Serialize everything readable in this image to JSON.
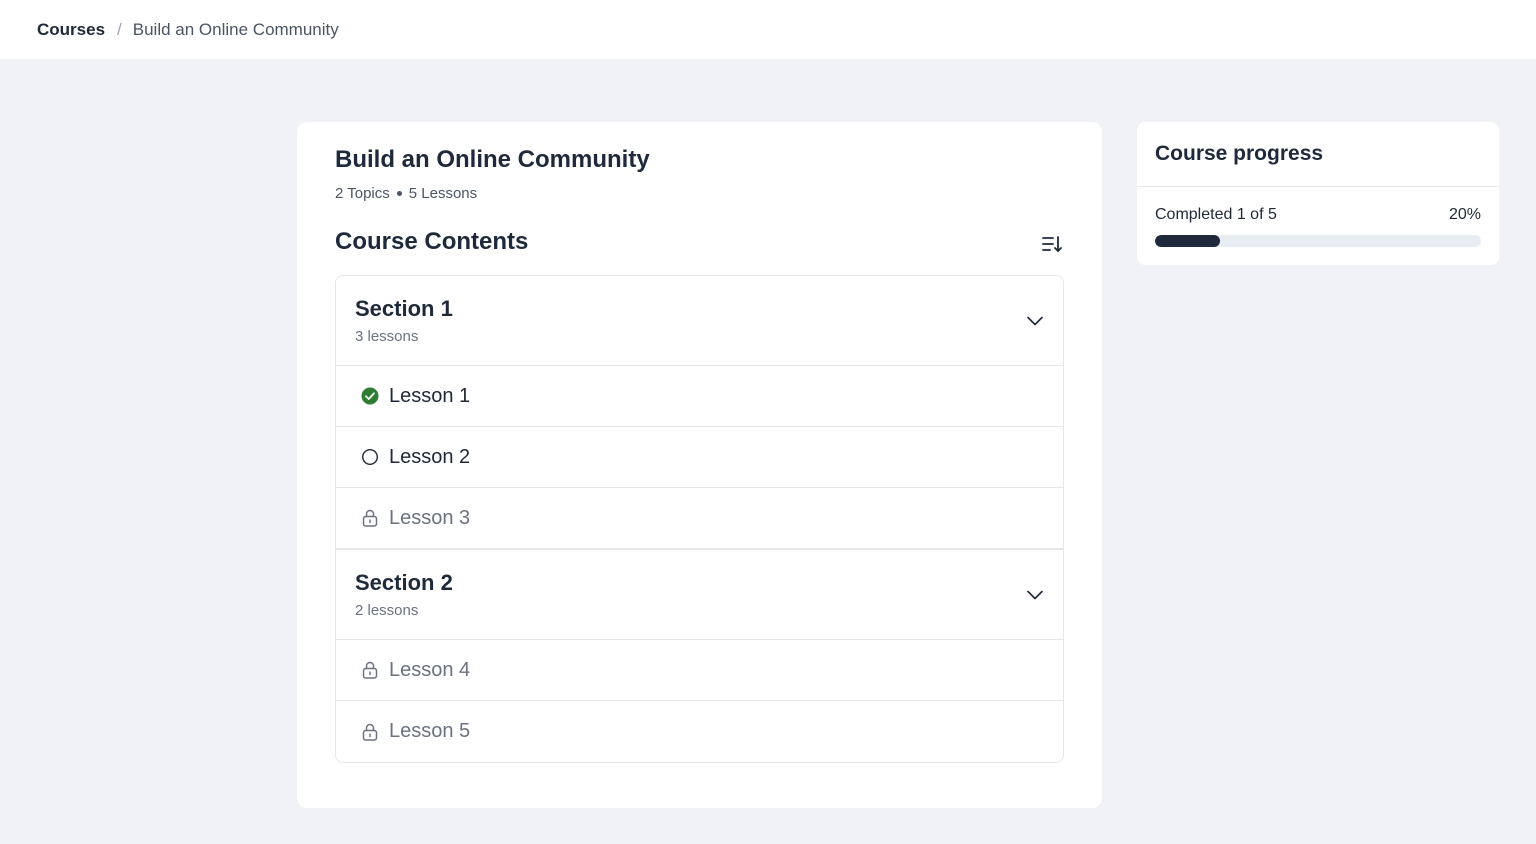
{
  "breadcrumb": {
    "root": "Courses",
    "separator": "/",
    "current": "Build an Online Community"
  },
  "course": {
    "title": "Build an Online Community",
    "topics": "2 Topics",
    "lessons": "5 Lessons"
  },
  "contents": {
    "heading": "Course Contents",
    "sort_icon": "sort-descending-icon",
    "sections": [
      {
        "name": "Section 1",
        "count": "3 lessons",
        "lessons": [
          {
            "label": "Lesson 1",
            "status": "completed"
          },
          {
            "label": "Lesson 2",
            "status": "available"
          },
          {
            "label": "Lesson 3",
            "status": "locked"
          }
        ]
      },
      {
        "name": "Section 2",
        "count": "2 lessons",
        "lessons": [
          {
            "label": "Lesson 4",
            "status": "locked"
          },
          {
            "label": "Lesson 5",
            "status": "locked"
          }
        ]
      }
    ]
  },
  "progress": {
    "title": "Course progress",
    "label": "Completed 1 of 5",
    "percent_text": "20%",
    "fraction": 0.2
  },
  "colors": {
    "completed_green": "#2e7d32",
    "progress_fill": "#1e293b",
    "background": "#f0f2f5"
  }
}
